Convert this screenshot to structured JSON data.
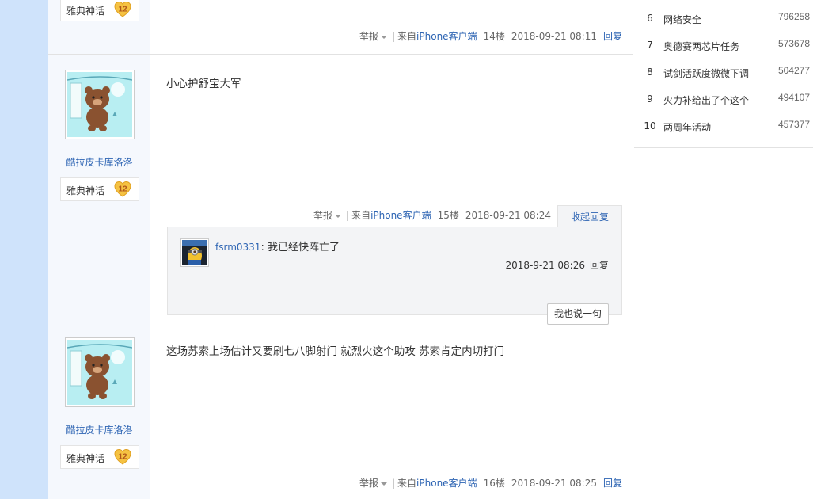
{
  "ranking": [
    {
      "num": "6",
      "title": "网络安全",
      "count": "796258"
    },
    {
      "num": "7",
      "title": "奥德赛两芯片任务",
      "count": "573678"
    },
    {
      "num": "8",
      "title": "试剑活跃度微微下调",
      "count": "504277"
    },
    {
      "num": "9",
      "title": "火力补给出了个这个",
      "count": "494107"
    },
    {
      "num": "10",
      "title": "两周年活动",
      "count": "457377"
    }
  ],
  "floor14": {
    "badge_label": "雅典神话",
    "badge_level": "12",
    "report": "举报",
    "client_prefix": "来自",
    "client": "iPhone客户端",
    "floor_num": "14楼",
    "time": "2018-09-21 08:11",
    "reply": "回复"
  },
  "floor15": {
    "username": "酷拉皮卡库洛洛",
    "badge_label": "雅典神话",
    "badge_level": "12",
    "content": "小心护舒宝大军",
    "report": "举报",
    "client_prefix": "来自",
    "client": "iPhone客户端",
    "floor_num": "15楼",
    "time": "2018-09-21 08:24",
    "collapse": "收起回复",
    "subreply": {
      "user": "fsrm0331",
      "text": ": 我已经快阵亡了",
      "time": "2018-9-21 08:26",
      "reply": "回复",
      "say_button": "我也说一句"
    }
  },
  "floor16": {
    "username": "酷拉皮卡库洛洛",
    "badge_label": "雅典神话",
    "badge_level": "12",
    "content": "这场苏索上场估计又要刷七八脚射门 就烈火这个助攻 苏索肯定内切打门",
    "report": "举报",
    "client_prefix": "来自",
    "client": "iPhone客户端",
    "floor_num": "16楼",
    "time": "2018-09-21 08:25",
    "reply": "回复"
  }
}
